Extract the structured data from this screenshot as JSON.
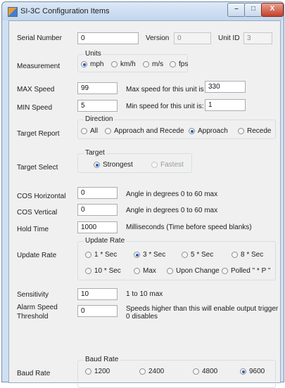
{
  "window": {
    "title": "SI-3C Configuration Items",
    "minimize_glyph": "–",
    "maximize_glyph": "□",
    "close_glyph": "X"
  },
  "serial": {
    "label": "Serial Number",
    "value": "0",
    "version_label": "Version",
    "version_value": "0",
    "unitid_label": "Unit ID",
    "unitid_value": "3"
  },
  "measurement": {
    "label": "Measurement",
    "group_title": "Units",
    "options": [
      "mph",
      "km/h",
      "m/s",
      "fps"
    ],
    "selected": "mph"
  },
  "max_speed": {
    "label": "MAX Speed",
    "value": "99",
    "note": "Max speed for this unit is",
    "max_value": "330"
  },
  "min_speed": {
    "label": "MIN Speed",
    "value": "5",
    "note": "Min speed for this unit is:",
    "min_value": "1"
  },
  "target_report": {
    "label": "Target Report",
    "group_title": "Direction",
    "options": [
      "All",
      "Approach and Recede",
      "Approach",
      "Recede"
    ],
    "selected": "Approach"
  },
  "target_select": {
    "label": "Target Select",
    "group_title": "Target",
    "options": [
      "Strongest",
      "Fastest"
    ],
    "selected": "Strongest",
    "disabled": [
      "Fastest"
    ]
  },
  "cos_horizontal": {
    "label": "COS Horizontal",
    "value": "0",
    "note": "Angle in degrees 0 to 60 max"
  },
  "cos_vertical": {
    "label": "COS Vertical",
    "value": "0",
    "note": "Angle in degrees 0 to 60 max"
  },
  "hold_time": {
    "label": "Hold Time",
    "value": "1000",
    "note": "Milliseconds  (Time before speed blanks)"
  },
  "update_rate": {
    "label": "Update Rate",
    "group_title": "Update Rate",
    "options": [
      "1 * Sec",
      "3 * Sec",
      "5 * Sec",
      "8 * Sec",
      "10 * Sec",
      "Max",
      "Upon Change",
      "Polled \" * P \""
    ],
    "selected": "3 * Sec"
  },
  "sensitivity": {
    "label": "Sensitivity",
    "value": "10",
    "note": "1 to 10 max"
  },
  "alarm_speed": {
    "label_line1": "Alarm Speed",
    "label_line2": "Threshold",
    "value": "0",
    "note_line1": "Speeds higher than this will enable output trigger",
    "note_line2": "0 disables"
  },
  "baud_rate": {
    "label": "Baud Rate",
    "group_title": "Baud Rate",
    "options": [
      "1200",
      "2400",
      "4800",
      "9600"
    ],
    "selected": "9600"
  }
}
